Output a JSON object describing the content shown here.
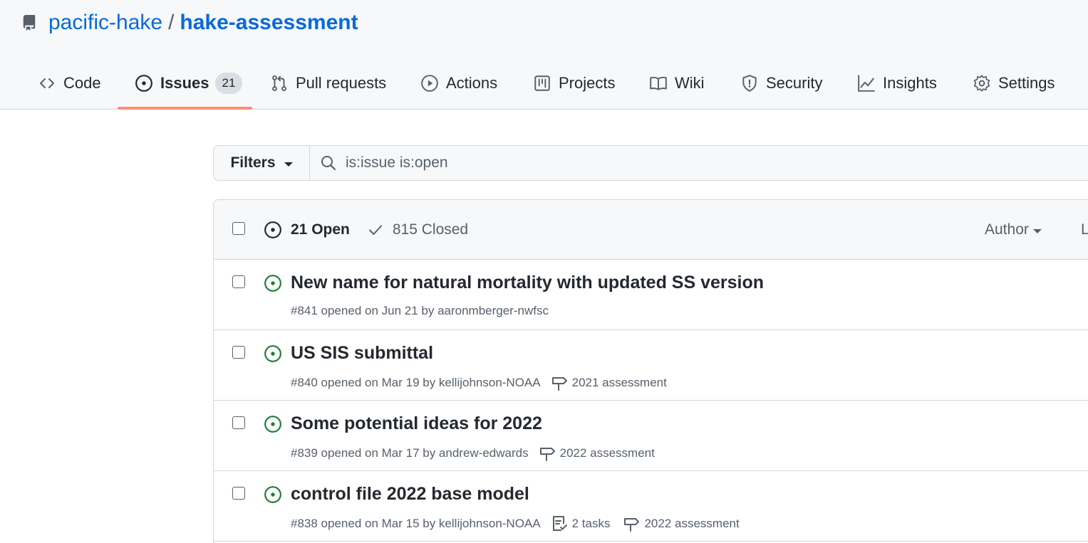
{
  "repo": {
    "owner": "pacific-hake",
    "separator": "/",
    "name": "hake-assessment"
  },
  "tabs": [
    {
      "label": "Code",
      "icon": "code-icon"
    },
    {
      "label": "Issues",
      "icon": "issue-opened-icon",
      "counter": "21",
      "selected": true
    },
    {
      "label": "Pull requests",
      "icon": "git-pull-request-icon"
    },
    {
      "label": "Actions",
      "icon": "play-icon"
    },
    {
      "label": "Projects",
      "icon": "project-icon"
    },
    {
      "label": "Wiki",
      "icon": "book-icon"
    },
    {
      "label": "Security",
      "icon": "shield-icon"
    },
    {
      "label": "Insights",
      "icon": "graph-icon"
    },
    {
      "label": "Settings",
      "icon": "gear-icon"
    }
  ],
  "filters": {
    "button_label": "Filters",
    "search_value": "is:issue is:open"
  },
  "list_header": {
    "open_label": "21 Open",
    "closed_label": "815 Closed",
    "author_label": "Author",
    "label_label": "L"
  },
  "issues": [
    {
      "title": "New name for natural mortality with updated SS version",
      "meta": "#841 opened on Jun 21 by aaronmberger-nwfsc",
      "tasks": "",
      "milestone": ""
    },
    {
      "title": "US SIS submittal",
      "meta": "#840 opened on Mar 19 by kellijohnson-NOAA",
      "tasks": "",
      "milestone": "2021 assessment"
    },
    {
      "title": "Some potential ideas for 2022",
      "meta": "#839 opened on Mar 17 by andrew-edwards",
      "tasks": "",
      "milestone": "2022 assessment"
    },
    {
      "title": "control file 2022 base model",
      "meta": "#838 opened on Mar 15 by kellijohnson-NOAA",
      "tasks": "2 tasks",
      "milestone": "2022 assessment"
    }
  ],
  "colors": {
    "link": "#0969da",
    "open_state": "#1a7f37",
    "selected_tab_underline": "#fd8c73"
  }
}
